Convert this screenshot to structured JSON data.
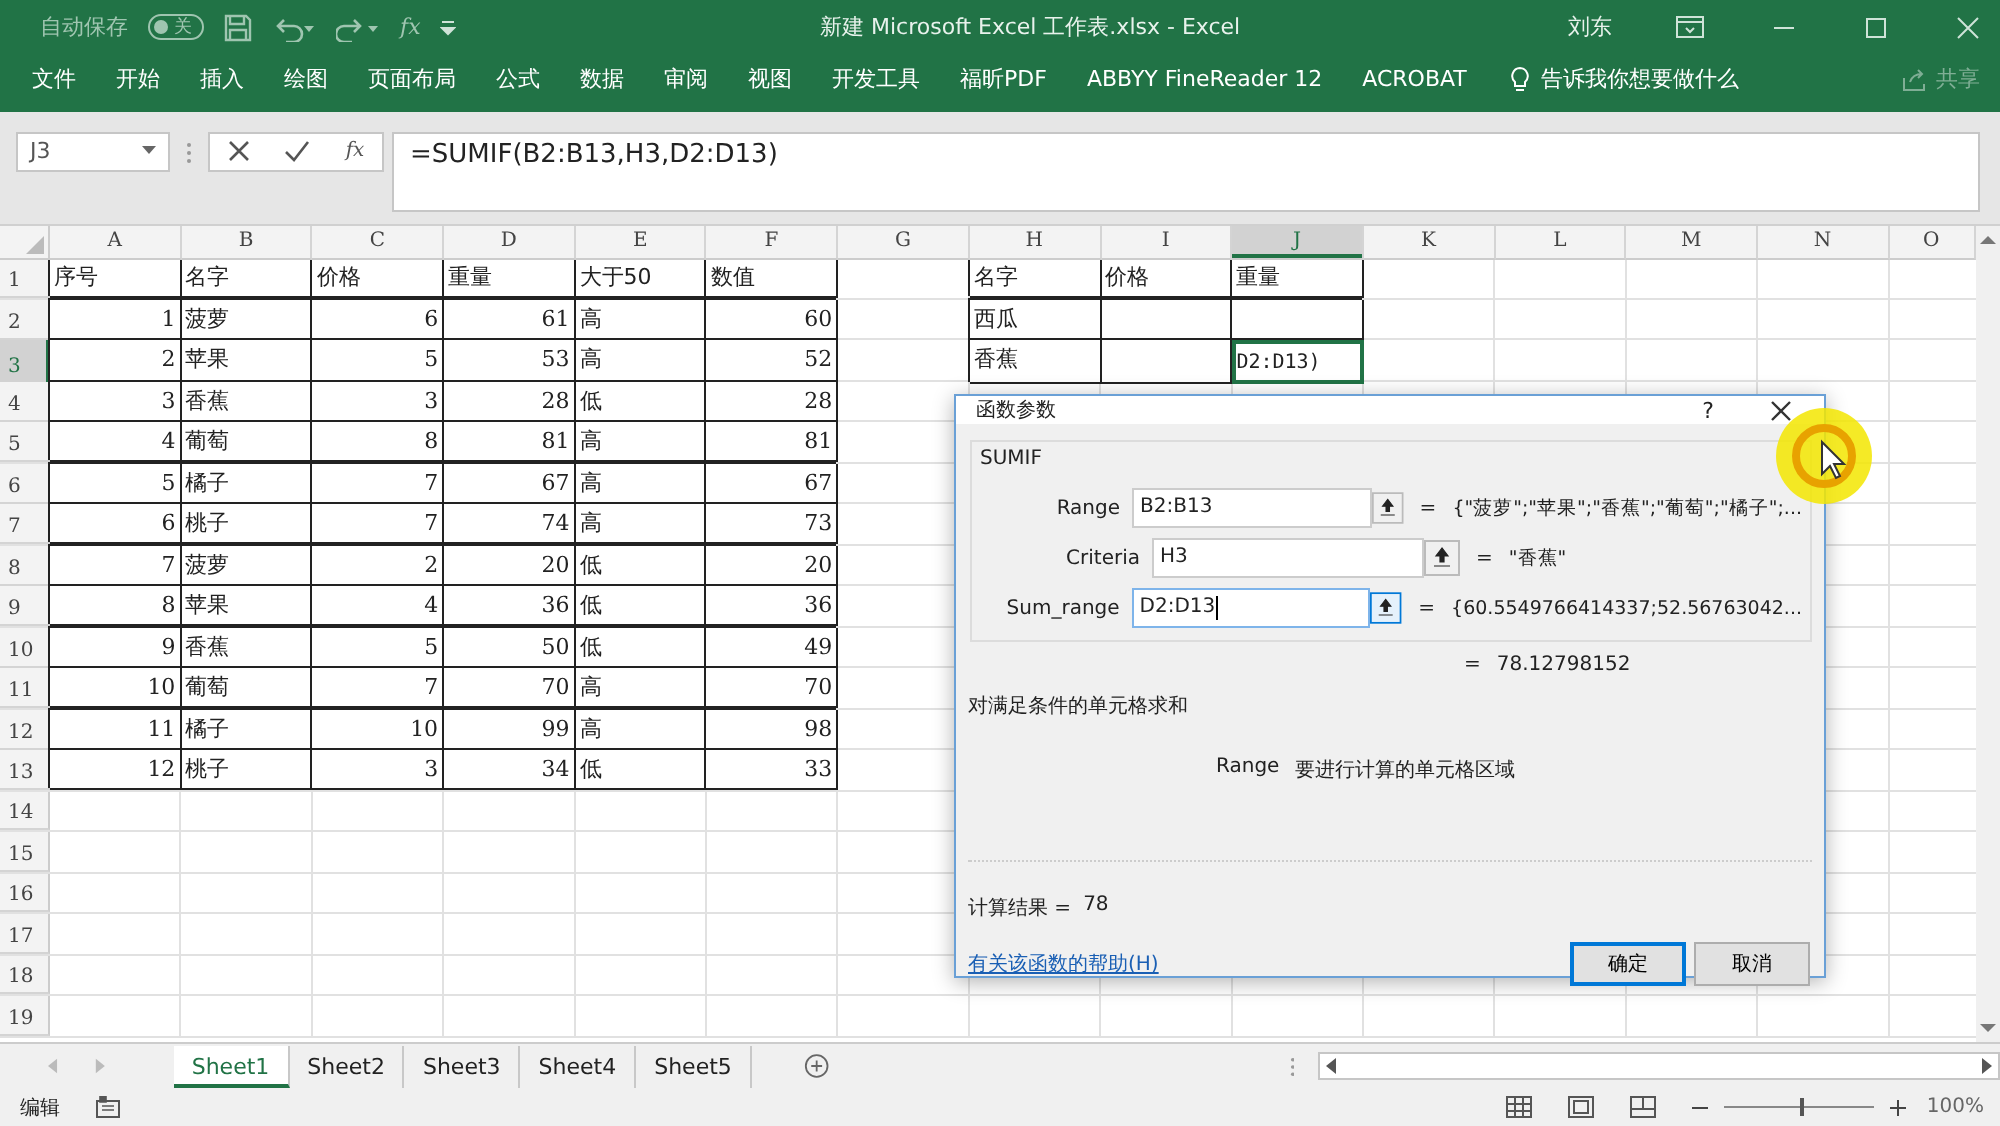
{
  "window": {
    "autosave_label": "自动保存",
    "autosave_state": "关",
    "autosave_on": false,
    "quick_fx": "fx",
    "title": "新建 Microsoft Excel 工作表.xlsx  -  Excel",
    "user": "刘东"
  },
  "ribbon_tabs": [
    {
      "label": "文件",
      "selected": false
    },
    {
      "label": "开始",
      "selected": false
    },
    {
      "label": "插入",
      "selected": false
    },
    {
      "label": "绘图",
      "selected": false
    },
    {
      "label": "页面布局",
      "selected": false
    },
    {
      "label": "公式",
      "selected": false
    },
    {
      "label": "数据",
      "selected": false
    },
    {
      "label": "审阅",
      "selected": false
    },
    {
      "label": "视图",
      "selected": false
    },
    {
      "label": "开发工具",
      "selected": false
    },
    {
      "label": "福昕PDF",
      "selected": false
    },
    {
      "label": "ABBYY FineReader 12",
      "selected": false
    },
    {
      "label": "ACROBAT",
      "selected": false
    }
  ],
  "tell_me": "告诉我你想要做什么",
  "share": "共享",
  "formula_bar": {
    "name_box": "J3",
    "fx": "fx",
    "formula": "=SUMIF(B2:B13,H3,D2:D13)"
  },
  "columns": [
    {
      "label": "A",
      "selected": false
    },
    {
      "label": "B",
      "selected": false
    },
    {
      "label": "C",
      "selected": false
    },
    {
      "label": "D",
      "selected": false
    },
    {
      "label": "E",
      "selected": false
    },
    {
      "label": "F",
      "selected": false
    },
    {
      "label": "G",
      "selected": false
    },
    {
      "label": "H",
      "selected": false
    },
    {
      "label": "I",
      "selected": false
    },
    {
      "label": "J",
      "selected": true
    },
    {
      "label": "K",
      "selected": false
    },
    {
      "label": "L",
      "selected": false
    },
    {
      "label": "M",
      "selected": false
    },
    {
      "label": "N",
      "selected": false
    },
    {
      "label": "O",
      "selected": false
    }
  ],
  "rows": [
    {
      "number": "1",
      "selected": false,
      "cells": [
        {
          "kind": "text",
          "text": "序号",
          "selected": false
        },
        {
          "kind": "text",
          "text": "名字",
          "selected": false
        },
        {
          "kind": "text",
          "text": "价格",
          "selected": false
        },
        {
          "kind": "text",
          "text": "重量",
          "selected": false
        },
        {
          "kind": "text",
          "text": "大于50",
          "selected": false
        },
        {
          "kind": "text",
          "text": "数值",
          "selected": false
        },
        {
          "kind": "blank"
        },
        {
          "kind": "text",
          "text": "名字",
          "selected": false
        },
        {
          "kind": "text",
          "text": "价格",
          "selected": false
        },
        {
          "kind": "text",
          "text": "重量",
          "selected": false
        }
      ]
    },
    {
      "number": "2",
      "selected": false,
      "cells": [
        {
          "kind": "number",
          "text": "1",
          "selected": false
        },
        {
          "kind": "text",
          "text": "菠萝",
          "selected": false
        },
        {
          "kind": "number",
          "text": "6",
          "selected": false
        },
        {
          "kind": "number",
          "text": "61",
          "selected": false
        },
        {
          "kind": "text",
          "text": "高",
          "selected": false
        },
        {
          "kind": "number",
          "text": "60",
          "selected": false
        },
        {
          "kind": "blank"
        },
        {
          "kind": "text",
          "text": "西瓜",
          "selected": false
        },
        {
          "kind": "empty",
          "selected": false
        },
        {
          "kind": "empty",
          "selected": false
        }
      ]
    },
    {
      "number": "3",
      "selected": true,
      "cells": [
        {
          "kind": "number",
          "text": "2",
          "selected": false
        },
        {
          "kind": "text",
          "text": "苹果",
          "selected": false
        },
        {
          "kind": "number",
          "text": "5",
          "selected": false
        },
        {
          "kind": "number",
          "text": "53",
          "selected": false
        },
        {
          "kind": "text",
          "text": "高",
          "selected": false
        },
        {
          "kind": "number",
          "text": "52",
          "selected": false
        },
        {
          "kind": "blank"
        },
        {
          "kind": "text",
          "text": "香蕉",
          "selected": false
        },
        {
          "kind": "empty",
          "selected": false
        },
        {
          "kind": "editing",
          "text": "D2:D13)",
          "selected": true
        }
      ]
    },
    {
      "number": "4",
      "selected": false,
      "cells": [
        {
          "kind": "number",
          "text": "3",
          "selected": false
        },
        {
          "kind": "text",
          "text": "香蕉",
          "selected": false
        },
        {
          "kind": "number",
          "text": "3",
          "selected": false
        },
        {
          "kind": "number",
          "text": "28",
          "selected": false
        },
        {
          "kind": "text",
          "text": "低",
          "selected": false
        },
        {
          "kind": "number",
          "text": "28",
          "selected": false
        }
      ]
    },
    {
      "number": "5",
      "selected": false,
      "cells": [
        {
          "kind": "number",
          "text": "4",
          "selected": false
        },
        {
          "kind": "text",
          "text": "葡萄",
          "selected": false
        },
        {
          "kind": "number",
          "text": "8",
          "selected": false
        },
        {
          "kind": "number",
          "text": "81",
          "selected": false
        },
        {
          "kind": "text",
          "text": "高",
          "selected": false
        },
        {
          "kind": "number",
          "text": "81",
          "selected": false
        }
      ]
    },
    {
      "number": "6",
      "selected": false,
      "cells": [
        {
          "kind": "number",
          "text": "5",
          "selected": false
        },
        {
          "kind": "text",
          "text": "橘子",
          "selected": false
        },
        {
          "kind": "number",
          "text": "7",
          "selected": false
        },
        {
          "kind": "number",
          "text": "67",
          "selected": false
        },
        {
          "kind": "text",
          "text": "高",
          "selected": false
        },
        {
          "kind": "number",
          "text": "67",
          "selected": false
        }
      ]
    },
    {
      "number": "7",
      "selected": false,
      "cells": [
        {
          "kind": "number",
          "text": "6",
          "selected": false
        },
        {
          "kind": "text",
          "text": "桃子",
          "selected": false
        },
        {
          "kind": "number",
          "text": "7",
          "selected": false
        },
        {
          "kind": "number",
          "text": "74",
          "selected": false
        },
        {
          "kind": "text",
          "text": "高",
          "selected": false
        },
        {
          "kind": "number",
          "text": "73",
          "selected": false
        }
      ]
    },
    {
      "number": "8",
      "selected": false,
      "cells": [
        {
          "kind": "number",
          "text": "7",
          "selected": false
        },
        {
          "kind": "text",
          "text": "菠萝",
          "selected": false
        },
        {
          "kind": "number",
          "text": "2",
          "selected": false
        },
        {
          "kind": "number",
          "text": "20",
          "selected": false
        },
        {
          "kind": "text",
          "text": "低",
          "selected": false
        },
        {
          "kind": "number",
          "text": "20",
          "selected": false
        }
      ]
    },
    {
      "number": "9",
      "selected": false,
      "cells": [
        {
          "kind": "number",
          "text": "8",
          "selected": false
        },
        {
          "kind": "text",
          "text": "苹果",
          "selected": false
        },
        {
          "kind": "number",
          "text": "4",
          "selected": false
        },
        {
          "kind": "number",
          "text": "36",
          "selected": false
        },
        {
          "kind": "text",
          "text": "低",
          "selected": false
        },
        {
          "kind": "number",
          "text": "36",
          "selected": false
        }
      ]
    },
    {
      "number": "10",
      "selected": false,
      "cells": [
        {
          "kind": "number",
          "text": "9",
          "selected": false
        },
        {
          "kind": "text",
          "text": "香蕉",
          "selected": false
        },
        {
          "kind": "number",
          "text": "5",
          "selected": false
        },
        {
          "kind": "number",
          "text": "50",
          "selected": false
        },
        {
          "kind": "text",
          "text": "低",
          "selected": false
        },
        {
          "kind": "number",
          "text": "49",
          "selected": false
        }
      ]
    },
    {
      "number": "11",
      "selected": false,
      "cells": [
        {
          "kind": "number",
          "text": "10",
          "selected": false
        },
        {
          "kind": "text",
          "text": "葡萄",
          "selected": false
        },
        {
          "kind": "number",
          "text": "7",
          "selected": false
        },
        {
          "kind": "number",
          "text": "70",
          "selected": false
        },
        {
          "kind": "text",
          "text": "高",
          "selected": false
        },
        {
          "kind": "number",
          "text": "70",
          "selected": false
        }
      ]
    },
    {
      "number": "12",
      "selected": false,
      "cells": [
        {
          "kind": "number",
          "text": "11",
          "selected": false
        },
        {
          "kind": "text",
          "text": "橘子",
          "selected": false
        },
        {
          "kind": "number",
          "text": "10",
          "selected": false
        },
        {
          "kind": "number",
          "text": "99",
          "selected": false
        },
        {
          "kind": "text",
          "text": "高",
          "selected": false
        },
        {
          "kind": "number",
          "text": "98",
          "selected": false
        }
      ]
    },
    {
      "number": "13",
      "selected": false,
      "cells": [
        {
          "kind": "number",
          "text": "12",
          "selected": false
        },
        {
          "kind": "text",
          "text": "桃子",
          "selected": false
        },
        {
          "kind": "number",
          "text": "3",
          "selected": false
        },
        {
          "kind": "number",
          "text": "34",
          "selected": false
        },
        {
          "kind": "text",
          "text": "低",
          "selected": false
        },
        {
          "kind": "number",
          "text": "33",
          "selected": false
        }
      ]
    },
    {
      "number": "14",
      "selected": false
    },
    {
      "number": "15",
      "selected": false
    },
    {
      "number": "16",
      "selected": false
    },
    {
      "number": "17",
      "selected": false
    },
    {
      "number": "18",
      "selected": false
    },
    {
      "number": "19",
      "selected": false
    }
  ],
  "dialog": {
    "title": "函数参数",
    "help": "?",
    "function_name": "SUMIF",
    "args": [
      {
        "label": "Range",
        "value": "B2:B13",
        "equals": "=",
        "result": "{\"菠萝\";\"苹果\";\"香蕉\";\"葡萄\";\"橘子\";...",
        "focused": false
      },
      {
        "label": "Criteria",
        "value": "H3",
        "equals": "=",
        "result": "\"香蕉\"",
        "focused": false
      },
      {
        "label": "Sum_range",
        "value": "D2:D13",
        "equals": "=",
        "result": "{60.5549766414337;52.56763042...",
        "focused": true
      }
    ],
    "total_equals": "=",
    "total": "78.12798152",
    "description": "对满足条件的单元格求和",
    "arg_help_name": "Range",
    "arg_help_text": "要进行计算的单元格区域",
    "result_label": "计算结果 =",
    "result_value": "78",
    "help_link": "有关该函数的帮助(H)",
    "buttons": [
      {
        "label": "确定",
        "selected": true
      },
      {
        "label": "取消",
        "selected": false
      }
    ]
  },
  "sheet_tabs": [
    {
      "label": "Sheet1",
      "selected": true
    },
    {
      "label": "Sheet2",
      "selected": false
    },
    {
      "label": "Sheet3",
      "selected": false
    },
    {
      "label": "Sheet4",
      "selected": false
    },
    {
      "label": "Sheet5",
      "selected": false
    }
  ],
  "status_bar": {
    "mode": "编辑",
    "zoom": {
      "level": 0.5,
      "label": "100%"
    }
  }
}
